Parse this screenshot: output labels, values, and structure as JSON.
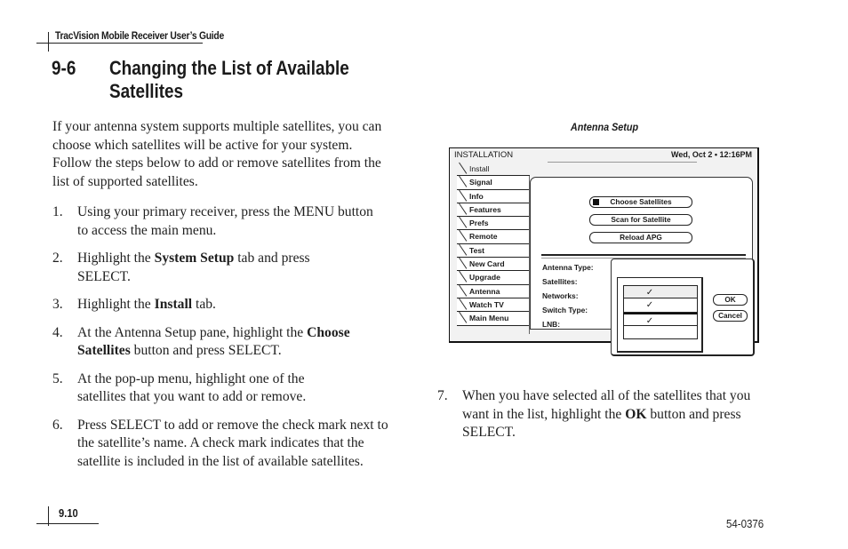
{
  "running_header": "TracVision Mobile Receiver User’s Guide",
  "section": {
    "number": "9-6",
    "title": "Changing the List of Available Satellites"
  },
  "intro": "If your antenna system supports multiple satellites, you can choose which satellites will be active for your system. Follow the steps below to add or remove satellites from the list of supported satellites.",
  "steps": [
    {
      "num": "1.",
      "parts": [
        {
          "t": "Using your primary receiver, press the MENU button to access the main menu."
        }
      ]
    },
    {
      "num": "2.",
      "parts": [
        {
          "t": "Highlight the "
        },
        {
          "t": "System Setup",
          "b": true
        },
        {
          "t": " tab and press SELECT."
        }
      ]
    },
    {
      "num": "3.",
      "parts": [
        {
          "t": "Highlight the "
        },
        {
          "t": "Install",
          "b": true
        },
        {
          "t": " tab."
        }
      ]
    },
    {
      "num": "4.",
      "parts": [
        {
          "t": "At the Antenna Setup pane, highlight the "
        },
        {
          "t": "Choose Satellites",
          "b": true
        },
        {
          "t": " button and press SELECT."
        }
      ]
    },
    {
      "num": "5.",
      "parts": [
        {
          "t": "At the pop-up menu, highlight one of the satellites that you want to add or remove."
        }
      ]
    },
    {
      "num": "6.",
      "parts": [
        {
          "t": "Press SELECT to add or remove the check mark next to the satellite’s name. A check mark indicates that the satellite is included in the list of available satellites."
        }
      ]
    },
    {
      "num": "7.",
      "parts": [
        {
          "t": "When you have selected all of the satellites that you want in the list, highlight the "
        },
        {
          "t": "OK",
          "b": true
        },
        {
          "t": " button and press SELECT."
        }
      ]
    }
  ],
  "figure": {
    "caption": "Antenna Setup",
    "screen": {
      "title": "INSTALLATION",
      "datetime": "Wed, Oct 2 • 12:16PM",
      "tabs": [
        "Install",
        "Signal",
        "Info",
        "Features",
        "Prefs",
        "Remote",
        "Test",
        "New Card",
        "Upgrade",
        "Antenna",
        "Watch TV",
        "Main Menu"
      ],
      "active_tab": "Install",
      "buttons": {
        "choose": "Choose Satellites",
        "scan": "Scan for Satellite",
        "reload": "Reload APG"
      },
      "info_labels": [
        "Antenna Type:",
        "Satellites:",
        "Networks:",
        "Switch Type:",
        "LNB:"
      ],
      "popup": {
        "rows": [
          {
            "check": "✓",
            "checked": true,
            "highlighted": true
          },
          {
            "check": "✓",
            "checked": true,
            "highlighted": false
          },
          {
            "check": "✓",
            "checked": true,
            "highlighted": false
          },
          {
            "check": "",
            "checked": false,
            "highlighted": false
          }
        ],
        "ok_label": "OK",
        "cancel_label": "Cancel"
      }
    }
  },
  "footer": {
    "page_number": "9.10",
    "doc_code": "54-0376"
  }
}
